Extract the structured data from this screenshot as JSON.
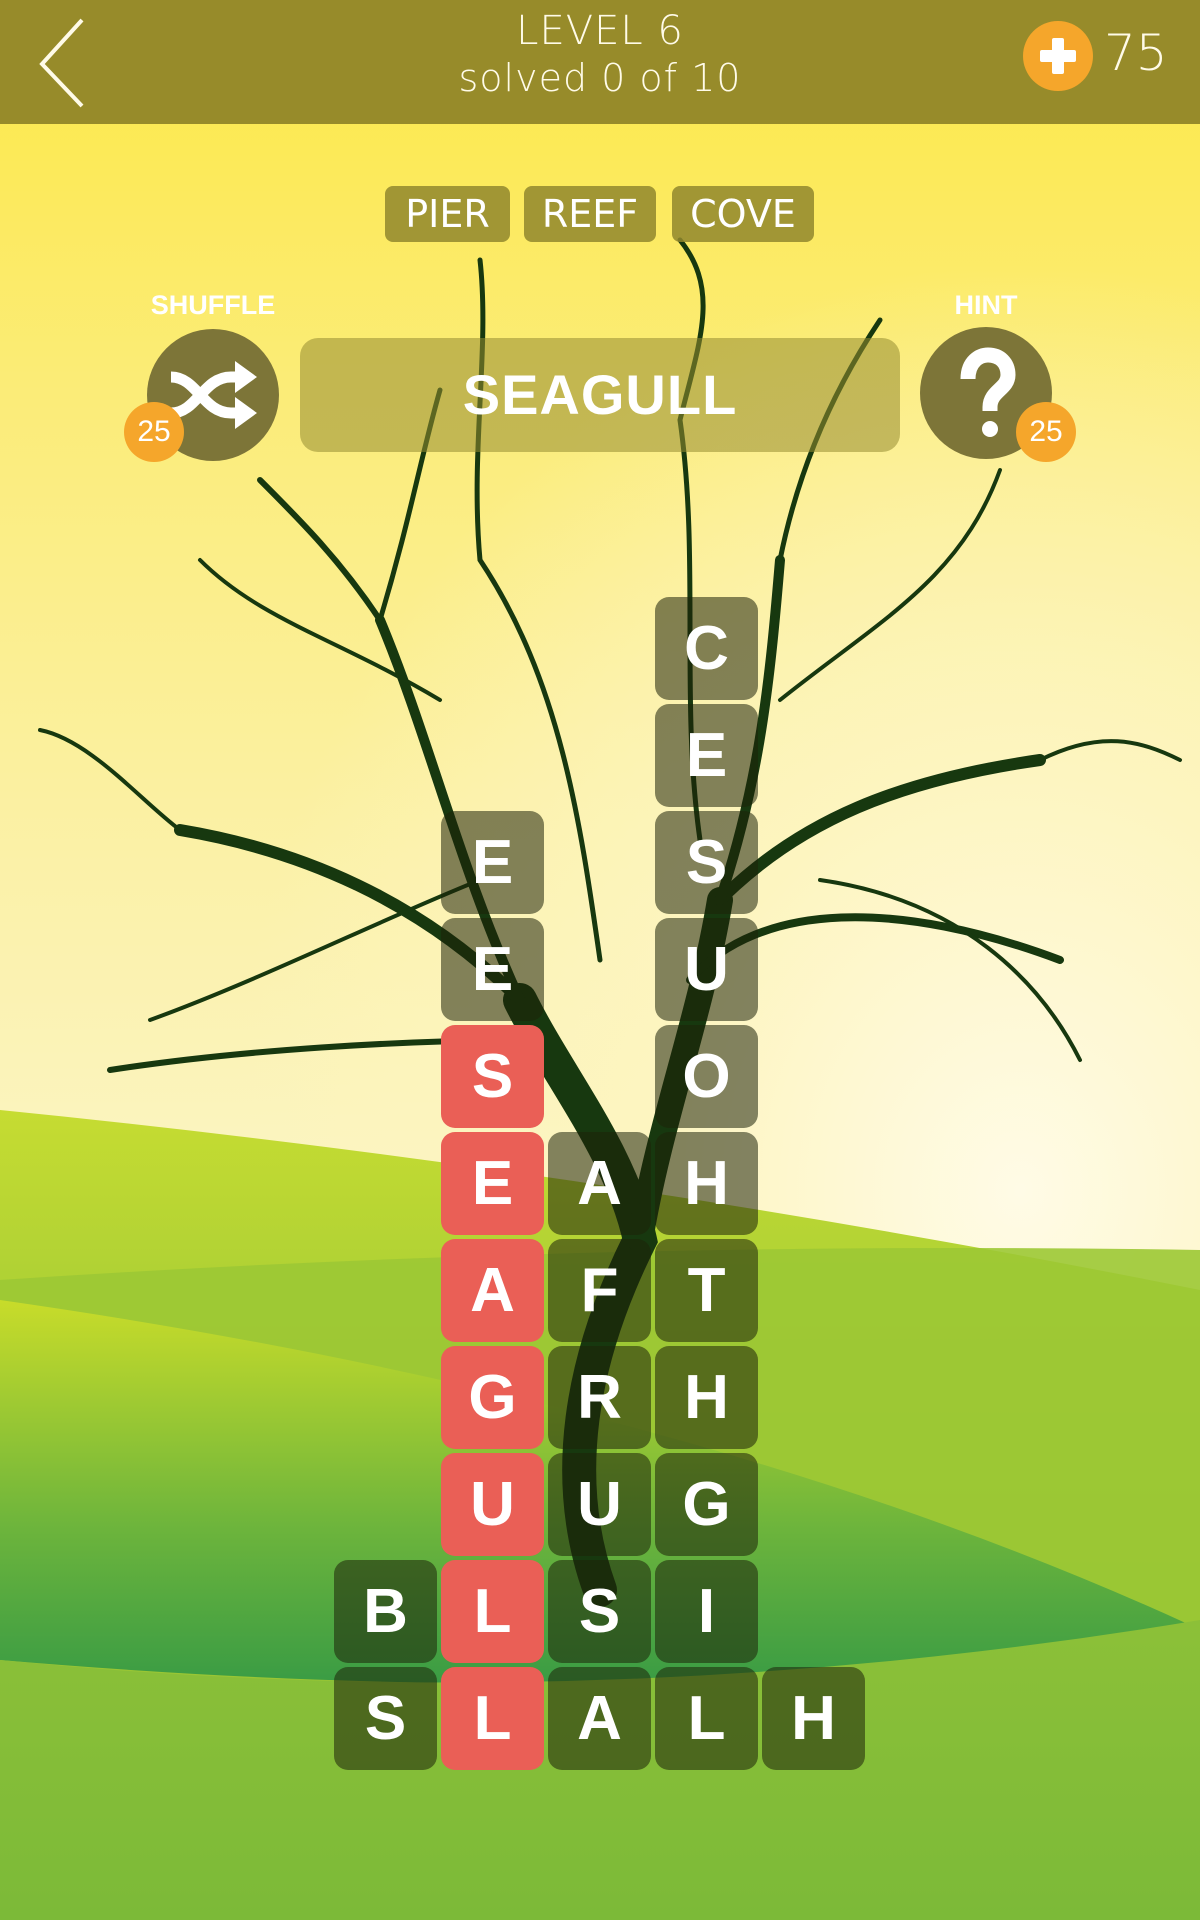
{
  "header": {
    "level_title": "LEVEL 6",
    "progress_text": "solved 0 of 10",
    "coins": "75"
  },
  "found_words": [
    "PIER",
    "REEF",
    "COVE"
  ],
  "actions": {
    "shuffle_label": "SHUFFLE",
    "shuffle_cost": "25",
    "hint_label": "HINT",
    "hint_cost": "25"
  },
  "current_word": "SEAGULL",
  "grid": {
    "columns": 5,
    "rows": 11,
    "tiles": [
      {
        "row": 0,
        "col": 3,
        "letter": "C",
        "selected": false
      },
      {
        "row": 1,
        "col": 3,
        "letter": "E",
        "selected": false
      },
      {
        "row": 2,
        "col": 1,
        "letter": "E",
        "selected": false
      },
      {
        "row": 2,
        "col": 3,
        "letter": "S",
        "selected": false
      },
      {
        "row": 3,
        "col": 1,
        "letter": "E",
        "selected": false
      },
      {
        "row": 3,
        "col": 3,
        "letter": "U",
        "selected": false
      },
      {
        "row": 4,
        "col": 1,
        "letter": "S",
        "selected": true
      },
      {
        "row": 4,
        "col": 3,
        "letter": "O",
        "selected": false
      },
      {
        "row": 5,
        "col": 1,
        "letter": "E",
        "selected": true
      },
      {
        "row": 5,
        "col": 2,
        "letter": "A",
        "selected": false
      },
      {
        "row": 5,
        "col": 3,
        "letter": "H",
        "selected": false
      },
      {
        "row": 6,
        "col": 1,
        "letter": "A",
        "selected": true
      },
      {
        "row": 6,
        "col": 2,
        "letter": "F",
        "selected": false
      },
      {
        "row": 6,
        "col": 3,
        "letter": "T",
        "selected": false
      },
      {
        "row": 7,
        "col": 1,
        "letter": "G",
        "selected": true
      },
      {
        "row": 7,
        "col": 2,
        "letter": "R",
        "selected": false
      },
      {
        "row": 7,
        "col": 3,
        "letter": "H",
        "selected": false
      },
      {
        "row": 8,
        "col": 1,
        "letter": "U",
        "selected": true
      },
      {
        "row": 8,
        "col": 2,
        "letter": "U",
        "selected": false
      },
      {
        "row": 8,
        "col": 3,
        "letter": "G",
        "selected": false
      },
      {
        "row": 9,
        "col": 0,
        "letter": "B",
        "selected": false
      },
      {
        "row": 9,
        "col": 1,
        "letter": "L",
        "selected": true
      },
      {
        "row": 9,
        "col": 2,
        "letter": "S",
        "selected": false
      },
      {
        "row": 9,
        "col": 3,
        "letter": "I",
        "selected": false
      },
      {
        "row": 10,
        "col": 0,
        "letter": "S",
        "selected": false
      },
      {
        "row": 10,
        "col": 1,
        "letter": "L",
        "selected": true
      },
      {
        "row": 10,
        "col": 2,
        "letter": "A",
        "selected": false
      },
      {
        "row": 10,
        "col": 3,
        "letter": "L",
        "selected": false
      },
      {
        "row": 10,
        "col": 4,
        "letter": "H",
        "selected": false
      }
    ]
  },
  "colors": {
    "header": "#978b2a",
    "accent_orange": "#f5a62b",
    "selected_tile": "#ea5f56",
    "tile_overlay": "rgba(30,35,10,0.55)",
    "tree": "#17380f"
  },
  "icons": {
    "back": "chevron-left-icon",
    "coins_add": "plus-icon",
    "shuffle": "shuffle-icon",
    "hint": "question-mark-icon"
  }
}
